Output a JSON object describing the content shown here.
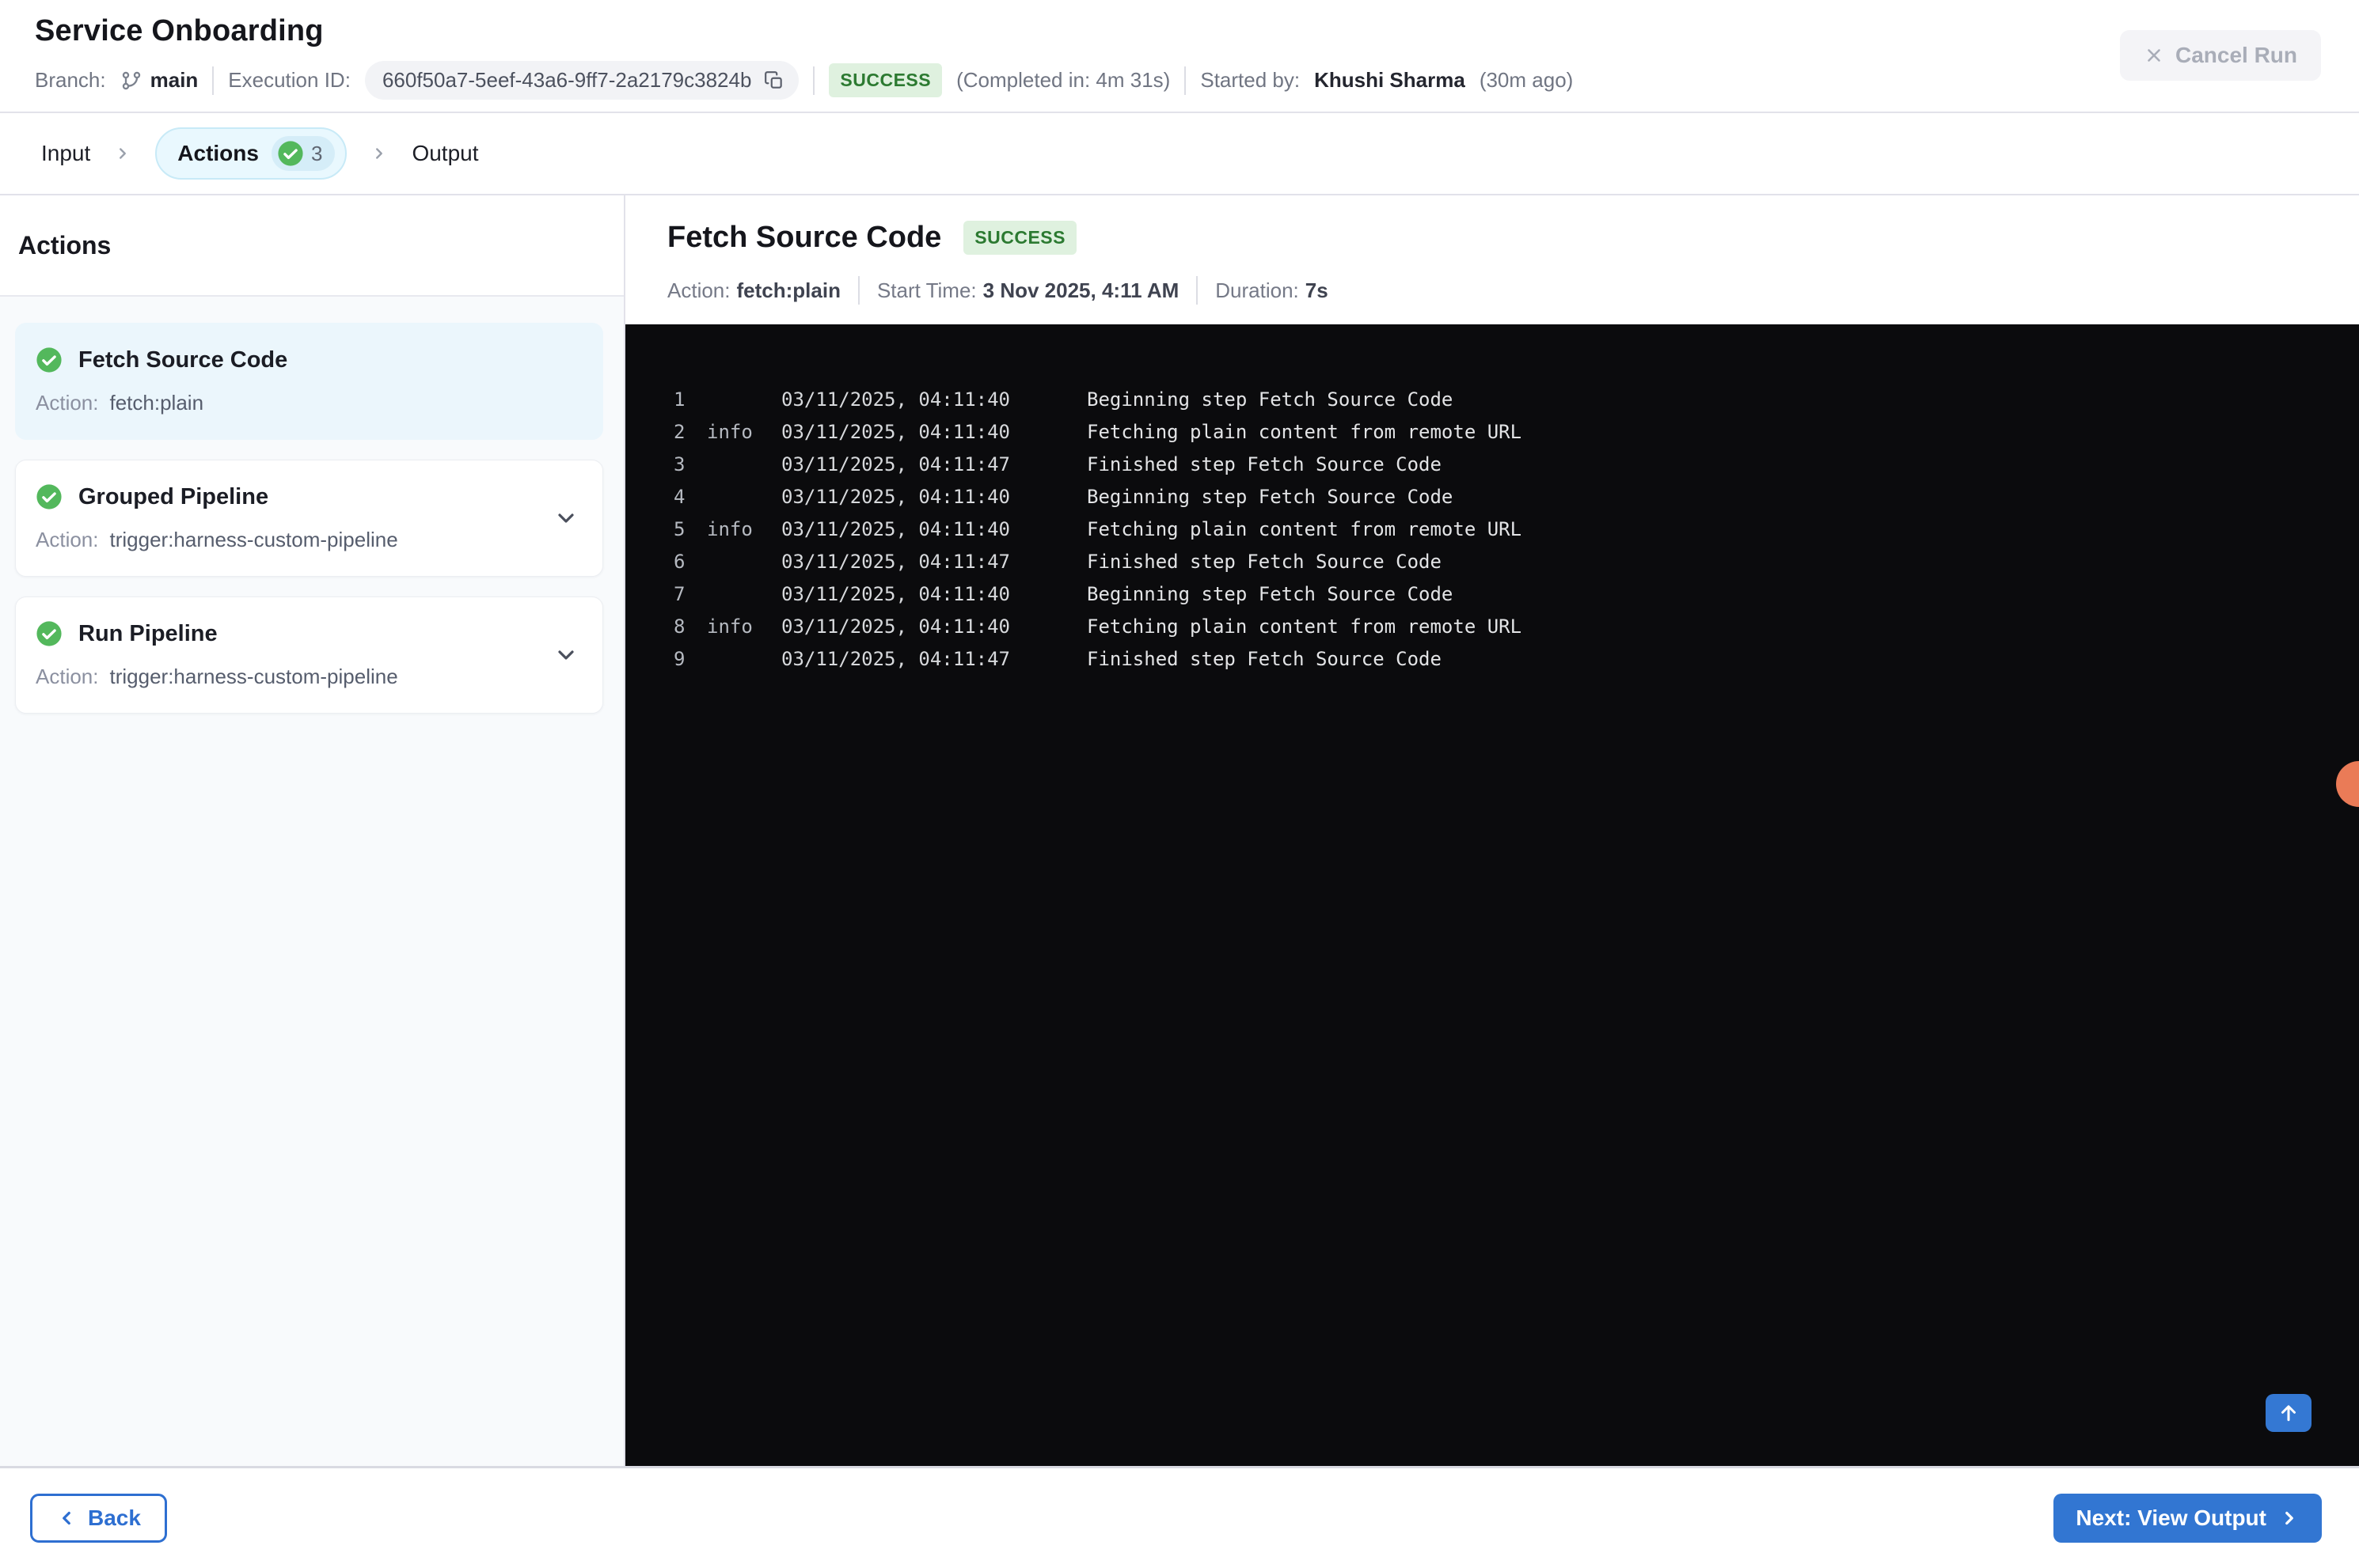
{
  "header": {
    "title": "Service Onboarding",
    "branch_label": "Branch:",
    "branch_name": "main",
    "execution_id_label": "Execution ID:",
    "execution_id": "660f50a7-5eef-43a6-9ff7-2a2179c3824b",
    "status_badge": "SUCCESS",
    "completed_in": "(Completed in: 4m 31s)",
    "started_by_label": "Started by:",
    "started_by_name": "Khushi Sharma",
    "started_ago": "(30m ago)",
    "cancel_button_label": "Cancel Run"
  },
  "stepper": {
    "tabs": [
      {
        "label": "Input"
      },
      {
        "label": "Actions",
        "badge_count": "3",
        "active": true
      },
      {
        "label": "Output"
      }
    ]
  },
  "sidebar": {
    "heading": "Actions",
    "items": [
      {
        "title": "Fetch Source Code",
        "action_label": "Action:",
        "action": "fetch:plain",
        "selected": true,
        "expandable": false,
        "status": "success"
      },
      {
        "title": "Grouped Pipeline",
        "action_label": "Action:",
        "action": "trigger:harness-custom-pipeline",
        "selected": false,
        "expandable": true,
        "status": "success"
      },
      {
        "title": "Run Pipeline",
        "action_label": "Action:",
        "action": "trigger:harness-custom-pipeline",
        "selected": false,
        "expandable": true,
        "status": "success"
      }
    ]
  },
  "detail": {
    "title": "Fetch Source Code",
    "status_badge": "SUCCESS",
    "meta": [
      {
        "label": "Action:",
        "value": "fetch:plain"
      },
      {
        "label": "Start Time:",
        "value": "3 Nov 2025, 4:11 AM"
      },
      {
        "label": "Duration:",
        "value": "7s"
      }
    ],
    "logs": [
      {
        "num": "1",
        "level": "",
        "time": "03/11/2025, 04:11:40",
        "message": "Beginning step Fetch Source Code"
      },
      {
        "num": "2",
        "level": "info",
        "time": "03/11/2025, 04:11:40",
        "message": "Fetching plain content from remote URL"
      },
      {
        "num": "3",
        "level": "",
        "time": "03/11/2025, 04:11:47",
        "message": "Finished step Fetch Source Code"
      },
      {
        "num": "4",
        "level": "",
        "time": "03/11/2025, 04:11:40",
        "message": "Beginning step Fetch Source Code"
      },
      {
        "num": "5",
        "level": "info",
        "time": "03/11/2025, 04:11:40",
        "message": "Fetching plain content from remote URL"
      },
      {
        "num": "6",
        "level": "",
        "time": "03/11/2025, 04:11:47",
        "message": "Finished step Fetch Source Code"
      },
      {
        "num": "7",
        "level": "",
        "time": "03/11/2025, 04:11:40",
        "message": "Beginning step Fetch Source Code"
      },
      {
        "num": "8",
        "level": "info",
        "time": "03/11/2025, 04:11:40",
        "message": "Fetching plain content from remote URL"
      },
      {
        "num": "9",
        "level": "",
        "time": "03/11/2025, 04:11:47",
        "message": "Finished step Fetch Source Code"
      }
    ]
  },
  "footer": {
    "back_label": "Back",
    "next_label": "Next: View Output"
  },
  "colors": {
    "accent_blue": "#3276d2",
    "success_green": "#53b85c",
    "success_badge_bg": "#dff1df",
    "success_badge_text": "#2c7a31",
    "active_tab_bg": "#e9f8fe",
    "console_bg": "#0b0b0d",
    "notification_dot": "#ea7b57"
  }
}
